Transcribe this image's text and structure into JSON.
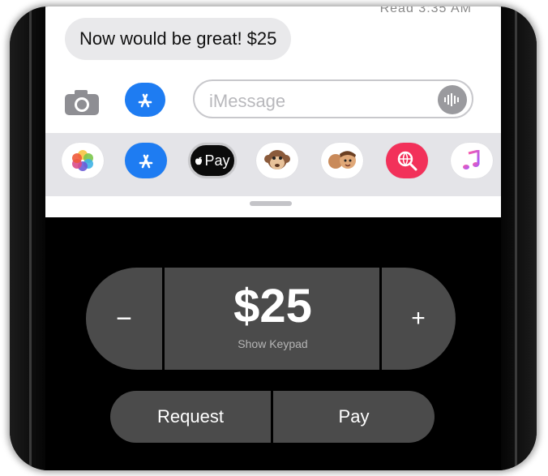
{
  "status_bar": {
    "time_partial": "Read 3:35 AM"
  },
  "conversation": {
    "last_message": "Now would be great! $25"
  },
  "composer": {
    "placeholder": "iMessage",
    "camera_icon": "camera-icon",
    "apps_icon": "app-store-icon",
    "audio_icon": "waveform-icon"
  },
  "app_tray": {
    "items": [
      {
        "name": "photos",
        "icon": "photos-icon"
      },
      {
        "name": "app-store",
        "icon": "app-store-icon"
      },
      {
        "name": "apple-pay",
        "label": "Pay",
        "icon": "apple-pay-icon"
      },
      {
        "name": "animoji",
        "icon": "monkey-icon"
      },
      {
        "name": "memoji",
        "icon": "memoji-icon"
      },
      {
        "name": "images-search",
        "icon": "globe-search-icon"
      },
      {
        "name": "music",
        "icon": "music-icon"
      }
    ]
  },
  "apple_pay": {
    "amount": "$25",
    "show_keypad": "Show Keypad",
    "decrement_label": "−",
    "increment_label": "+",
    "request_label": "Request",
    "pay_label": "Pay"
  },
  "colors": {
    "accent_blue": "#1E7CF2",
    "panel_gray": "#4B4B4B",
    "bubble_gray": "#E9E9EB",
    "search_red": "#F2315A"
  }
}
